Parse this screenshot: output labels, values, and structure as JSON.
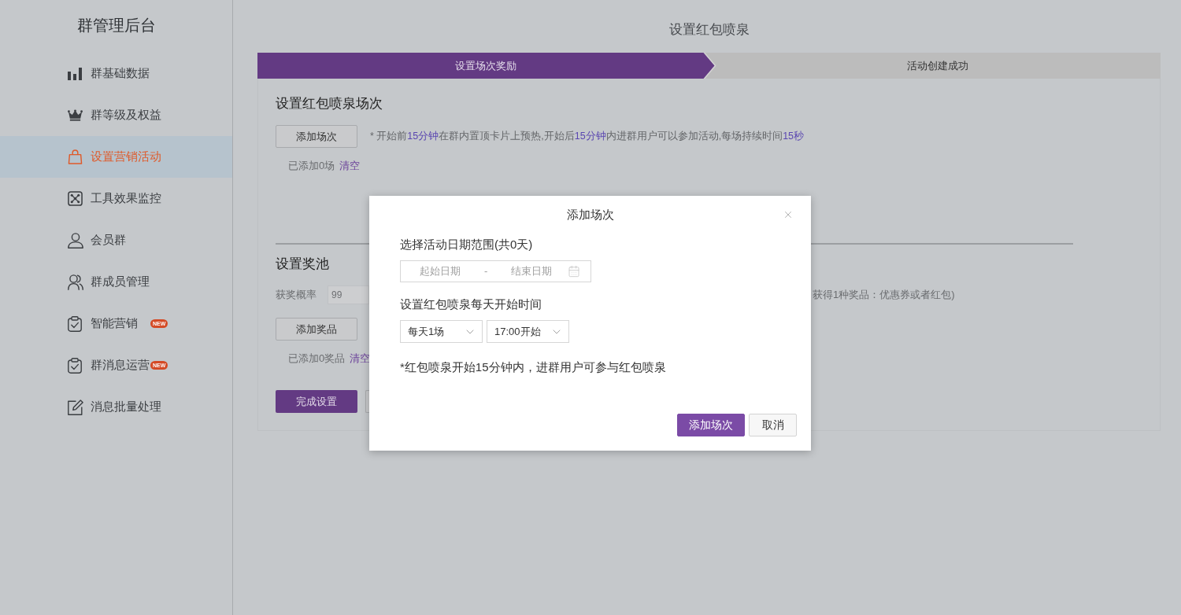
{
  "sidebar": {
    "title": "群管理后台",
    "items": [
      {
        "label": "群基础数据",
        "selected": false
      },
      {
        "label": "群等级及权益",
        "selected": false
      },
      {
        "label": "设置营销活动",
        "selected": true
      },
      {
        "label": "工具效果监控",
        "selected": false
      },
      {
        "label": "会员群",
        "selected": false
      },
      {
        "label": "群成员管理",
        "selected": false
      },
      {
        "label": "智能营销",
        "selected": false,
        "badge": "NEW"
      },
      {
        "label": "群消息运营",
        "selected": false,
        "badge": "NEW"
      },
      {
        "label": "消息批量处理",
        "selected": false
      }
    ]
  },
  "page": {
    "title": "设置红包喷泉"
  },
  "steps": [
    {
      "label": "设置场次奖励",
      "selected": true
    },
    {
      "label": "活动创建成功",
      "selected": false
    }
  ],
  "sessions_section": {
    "title": "设置红包喷泉场次",
    "add_button": "添加场次",
    "hint": [
      {
        "text": "* 开始前",
        "highlight": false
      },
      {
        "text": "15分钟",
        "highlight": true
      },
      {
        "text": "在群内置顶卡片上预热,开始后",
        "highlight": false
      },
      {
        "text": "15分钟",
        "highlight": true
      },
      {
        "text": "内进群用户可以参加活动,每场持续时间",
        "highlight": false
      },
      {
        "text": "15秒",
        "highlight": true
      }
    ],
    "count_text": "已添加0场",
    "clear_link": "清空"
  },
  "prize_pool": {
    "title": "设置奖池",
    "probability": {
      "label": "获奖概率",
      "value": "99",
      "disabled": true
    },
    "hint_visible": "获得1种奖品：优惠券或者红包)",
    "add_button": "添加奖品",
    "count_text": "已添加0奖品",
    "clear_link": "清空"
  },
  "footer": {
    "done_button": "完成设置"
  },
  "dialog": {
    "title": "添加场次",
    "date_label": "选择活动日期范围(共0天)",
    "date_range": {
      "start": {
        "placeholder": "起始日期"
      },
      "separator": "-",
      "end": {
        "placeholder": "结束日期"
      }
    },
    "time_label": "设置红包喷泉每天开始时间",
    "selects": [
      {
        "value": "每天1场"
      },
      {
        "value": "17:00开始"
      }
    ],
    "note": "*红包喷泉开始15分钟内，进群用户可参与红包喷泉",
    "buttons": [
      {
        "label": "添加场次",
        "kind": "primary"
      },
      {
        "label": "取消",
        "kind": "secondary"
      }
    ]
  }
}
